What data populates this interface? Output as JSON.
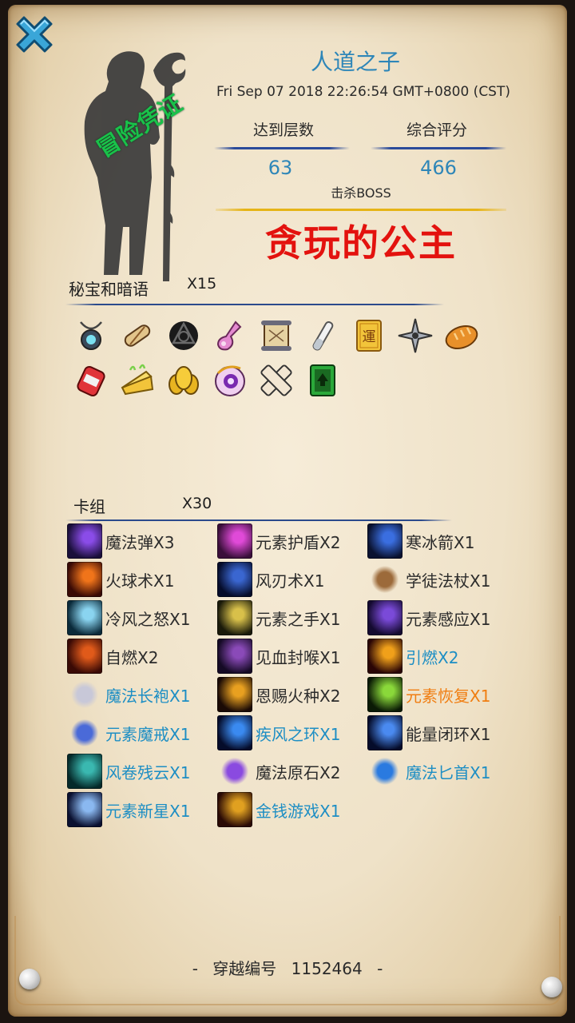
{
  "profile": {
    "player_name": "人道之子",
    "timestamp": "Fri Sep 07 2018 22:26:54 GMT+0800 (CST)",
    "stamp_text": "冒险凭证",
    "floors_label": "达到层数",
    "floors_value": "63",
    "score_label": "综合评分",
    "score_value": "466",
    "boss_label": "击杀BOSS",
    "boss_name": "贪玩的公主"
  },
  "treasures": {
    "title": "秘宝和暗语",
    "count": "X15",
    "items": [
      {
        "icon": "amulet-icon"
      },
      {
        "icon": "scroll-roll-icon"
      },
      {
        "icon": "dark-sigil-icon"
      },
      {
        "icon": "pink-potion-icon"
      },
      {
        "icon": "map-scroll-icon"
      },
      {
        "icon": "test-tube-icon"
      },
      {
        "icon": "fortune-card-icon",
        "glyph": "運"
      },
      {
        "icon": "shuriken-icon"
      },
      {
        "icon": "bread-icon"
      },
      {
        "icon": "red-can-icon"
      },
      {
        "icon": "cheese-icon"
      },
      {
        "icon": "golden-egg-icon"
      },
      {
        "icon": "eye-orb-icon"
      },
      {
        "icon": "bandage-icon"
      },
      {
        "icon": "green-card-icon"
      }
    ]
  },
  "deck": {
    "title": "卡组",
    "count": "X30",
    "cards": [
      {
        "name": "魔法弹X3",
        "style": "normal",
        "icon": "magic-missile-icon",
        "colors": [
          "#1a0f3a",
          "#8a4ce8"
        ]
      },
      {
        "name": "元素护盾X2",
        "style": "normal",
        "icon": "element-shield-icon",
        "colors": [
          "#3a0f3a",
          "#e04ad8"
        ]
      },
      {
        "name": "寒冰箭X1",
        "style": "normal",
        "icon": "ice-arrow-icon",
        "colors": [
          "#0a1230",
          "#3a6ee0"
        ]
      },
      {
        "name": "火球术X1",
        "style": "normal",
        "icon": "fireball-icon",
        "colors": [
          "#3a0a05",
          "#f0741a"
        ]
      },
      {
        "name": "风刃术X1",
        "style": "normal",
        "icon": "wind-blade-icon",
        "colors": [
          "#050c2a",
          "#3a66d0"
        ]
      },
      {
        "name": "学徒法杖X1",
        "style": "normal",
        "icon": "apprentice-staff-icon",
        "colors": [
          "#efe2c8",
          "#9c6a3a"
        ]
      },
      {
        "name": "冷风之怒X1",
        "style": "normal",
        "icon": "cold-wind-icon",
        "colors": [
          "#0a2a3a",
          "#8ad4f0"
        ]
      },
      {
        "name": "元素之手X1",
        "style": "normal",
        "icon": "element-hand-icon",
        "colors": [
          "#1a1a0a",
          "#d8c04a"
        ]
      },
      {
        "name": "元素感应X1",
        "style": "normal",
        "icon": "element-sense-icon",
        "colors": [
          "#140a30",
          "#7a4ad8"
        ]
      },
      {
        "name": "自燃X2",
        "style": "normal",
        "icon": "self-ignite-icon",
        "colors": [
          "#3a0a05",
          "#e05a1a"
        ]
      },
      {
        "name": "见血封喉X1",
        "style": "normal",
        "icon": "blood-seal-icon",
        "colors": [
          "#150a25",
          "#8a4ab8"
        ]
      },
      {
        "name": "引燃X2",
        "style": "blue",
        "icon": "ignite-icon",
        "colors": [
          "#2a0505",
          "#f0a01a"
        ]
      },
      {
        "name": "魔法长袍X1",
        "style": "blue",
        "icon": "magic-robe-icon",
        "colors": [
          "#efe2c8",
          "#c8c8d8"
        ]
      },
      {
        "name": "恩赐火种X2",
        "style": "normal",
        "icon": "fire-seed-icon",
        "colors": [
          "#1a0a05",
          "#e8a020"
        ]
      },
      {
        "name": "元素恢复X1",
        "style": "orange",
        "icon": "element-restore-icon",
        "colors": [
          "#0a1a05",
          "#8ad83a"
        ]
      },
      {
        "name": "元素魔戒X1",
        "style": "blue",
        "icon": "element-ring-icon",
        "colors": [
          "#efe2c8",
          "#4a6ad8"
        ]
      },
      {
        "name": "疾风之环X1",
        "style": "blue",
        "icon": "gale-ring-icon",
        "colors": [
          "#050c2a",
          "#3a8af0"
        ]
      },
      {
        "name": "能量闭环X1",
        "style": "normal",
        "icon": "energy-loop-icon",
        "colors": [
          "#050c2a",
          "#4a8af0"
        ]
      },
      {
        "name": "风卷残云X1",
        "style": "blue",
        "icon": "whirlwind-icon",
        "colors": [
          "#052a2a",
          "#3ab8b0"
        ]
      },
      {
        "name": "魔法原石X2",
        "style": "normal",
        "icon": "magic-stone-icon",
        "colors": [
          "#efe2c8",
          "#8a4ae0"
        ]
      },
      {
        "name": "魔法匕首X1",
        "style": "blue",
        "icon": "magic-dagger-icon",
        "colors": [
          "#efe2c8",
          "#2a7ae0"
        ]
      },
      {
        "name": "元素新星X1",
        "style": "blue",
        "icon": "element-nova-icon",
        "colors": [
          "#0a1030",
          "#8ab8f0"
        ]
      },
      {
        "name": "金钱游戏X1",
        "style": "blue",
        "icon": "money-game-icon",
        "colors": [
          "#2a0a05",
          "#e0a020"
        ]
      }
    ]
  },
  "footer": {
    "dash_left": "-",
    "label": "穿越编号",
    "number": "1152464",
    "dash_right": "-"
  },
  "close": {
    "icon": "close-icon"
  }
}
